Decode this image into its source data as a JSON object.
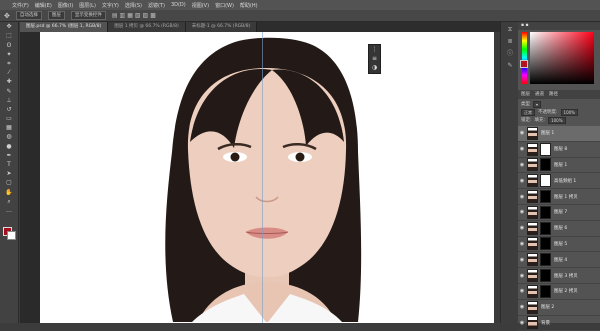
{
  "menubar": {
    "items": [
      "文件(F)",
      "编辑(E)",
      "图像(I)",
      "图层(L)",
      "文字(Y)",
      "选择(S)",
      "滤镜(T)",
      "3D(D)",
      "视图(V)",
      "窗口(W)",
      "帮助(H)"
    ]
  },
  "options": {
    "chip1": "自动选择",
    "chip2": "图层",
    "chip3": "显示变换控件"
  },
  "tabs": [
    {
      "label": "图层.psd @ 66.7% (图层 1, RGB/8)"
    },
    {
      "label": "图层 1 拷贝 @ 66.7% (RGB/8)"
    },
    {
      "label": "未标题-1 @ 66.7% (RGB/8)"
    }
  ],
  "layers_panel": {
    "tabs": [
      "图层",
      "通道",
      "路径"
    ],
    "mode_label": "正常",
    "opacity_label": "不透明度:",
    "opacity_value": "100%",
    "fill_label": "填充:",
    "fill_value": "100%",
    "lock_label": "锁定:",
    "kind_label": "类型"
  },
  "layers": [
    {
      "name": "图层 1",
      "mask": "none",
      "selected": true
    },
    {
      "name": "图层 8",
      "mask": "white",
      "selected": false
    },
    {
      "name": "图层 1",
      "mask": "black",
      "selected": false
    },
    {
      "name": "高低频组 1",
      "mask": "white",
      "selected": false
    },
    {
      "name": "图层 1 拷贝",
      "mask": "black",
      "selected": false
    },
    {
      "name": "图层 7",
      "mask": "black",
      "selected": false
    },
    {
      "name": "图层 6",
      "mask": "black",
      "selected": false
    },
    {
      "name": "图层 5",
      "mask": "black",
      "selected": false
    },
    {
      "name": "图层 4",
      "mask": "black",
      "selected": false
    },
    {
      "name": "图层 3 拷贝",
      "mask": "black",
      "selected": false
    },
    {
      "name": "图层 2 拷贝",
      "mask": "black",
      "selected": false
    },
    {
      "name": "图层 2",
      "mask": "none",
      "selected": false
    },
    {
      "name": "背景",
      "mask": "none",
      "selected": false
    }
  ],
  "colors": {
    "foreground": "#a4101e",
    "background": "#ffffff",
    "canvas_bg": "#ffffff"
  },
  "icons": {
    "toolbar": [
      "move-icon",
      "marquee-icon",
      "lasso-icon",
      "magic-wand-icon",
      "crop-icon",
      "eyedropper-icon",
      "healing-icon",
      "brush-icon",
      "clone-stamp-icon",
      "history-brush-icon",
      "eraser-icon",
      "gradient-icon",
      "blur-icon",
      "dodge-icon",
      "pen-icon",
      "type-icon",
      "path-select-icon",
      "shape-icon",
      "hand-icon",
      "zoom-icon",
      "more-tools-icon"
    ]
  }
}
